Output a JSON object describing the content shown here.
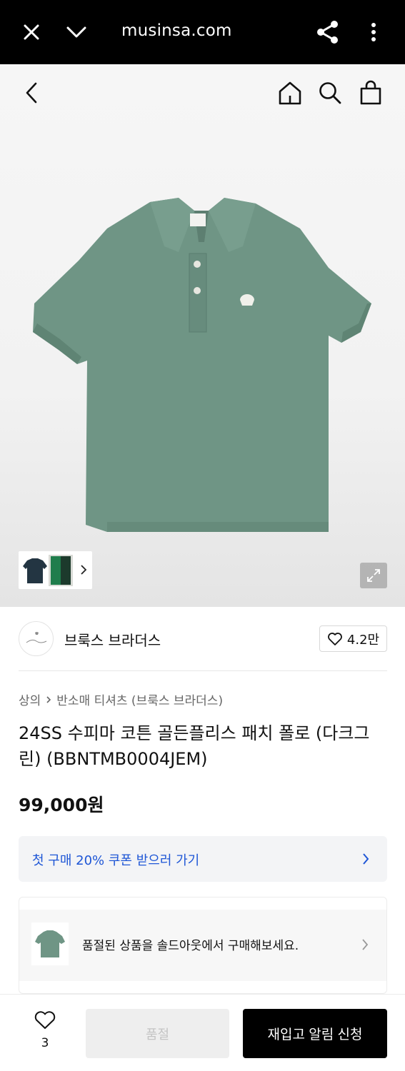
{
  "browser": {
    "url": "musinsa.com",
    "icons": [
      "close-icon",
      "chevron-down-icon",
      "share-icon",
      "more-vertical-icon"
    ]
  },
  "header": {
    "icons": [
      "back-icon",
      "home-icon",
      "search-icon",
      "bag-icon"
    ]
  },
  "product_image": {
    "shirt_color": "#6f9585",
    "thumbnail_count": 2
  },
  "brand": {
    "name": "브룩스 브라더스",
    "like_count": "4.2만"
  },
  "breadcrumb": {
    "category": "상의",
    "subcategory": "반소매 티셔츠 (브룩스 브라더스)"
  },
  "product": {
    "title": "24SS 수피마 코튼 골든플리스 패치 폴로 (다크그린) (BBNTMB0004JEM)",
    "price": "99,000원"
  },
  "coupon": {
    "text": "첫 구매 20% 쿠폰 받으러 가기",
    "color": "#1e56d6"
  },
  "soldout_banner": {
    "text": "품절된 상품을 솔드아웃에서 구매해보세요."
  },
  "bottom_bar": {
    "wish_count": "3",
    "soldout_label": "품절",
    "restock_label": "재입고 알림 신청"
  }
}
